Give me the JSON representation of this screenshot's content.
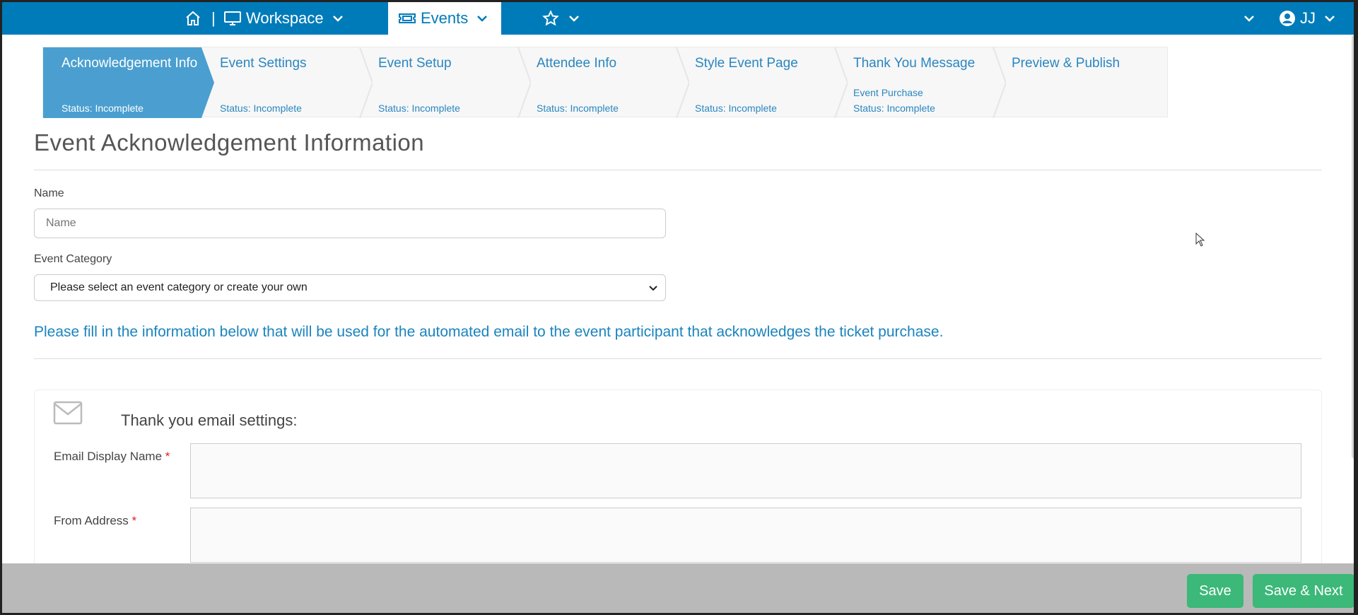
{
  "topnav": {
    "workspace_label": "Workspace",
    "events_label": "Events",
    "separator": "|",
    "user_initials": "JJ"
  },
  "steps": [
    {
      "title": "Acknowledgement Info",
      "extra": "",
      "status": "Status: Incomplete",
      "active": true
    },
    {
      "title": "Event Settings",
      "extra": "",
      "status": "Status: Incomplete",
      "active": false
    },
    {
      "title": "Event Setup",
      "extra": "",
      "status": "Status: Incomplete",
      "active": false
    },
    {
      "title": "Attendee Info",
      "extra": "",
      "status": "Status: Incomplete",
      "active": false
    },
    {
      "title": "Style Event Page",
      "extra": "",
      "status": "Status: Incomplete",
      "active": false
    },
    {
      "title": "Thank You Message",
      "extra": "Event Purchase",
      "status": "Status: Incomplete",
      "active": false
    },
    {
      "title": "Preview & Publish",
      "extra": "",
      "status": "",
      "active": false
    }
  ],
  "form": {
    "page_title": "Event Acknowledgement Information",
    "name_label": "Name",
    "name_placeholder": "Name",
    "category_label": "Event Category",
    "category_selected": "Please select an event category or create your own",
    "info_text": "Please fill in the information below that will be used for the automated email to the event participant that acknowledges the ticket purchase.",
    "panel_title": "Thank you email settings:",
    "display_name_label": "Email Display Name",
    "from_address_label": "From Address",
    "required_mark": "*"
  },
  "footer": {
    "save_label": "Save",
    "save_next_label": "Save & Next"
  },
  "colors": {
    "nav_blue": "#007bba",
    "step_active": "#4a9fd0",
    "link_blue": "#1a84be",
    "button_green": "#3cb878",
    "footer_gray": "#b9b9b9"
  },
  "icons": [
    "home-icon",
    "monitor-icon",
    "ticket-icon",
    "star-icon",
    "user-circle-icon",
    "chevron-down-icon",
    "mail-icon"
  ]
}
